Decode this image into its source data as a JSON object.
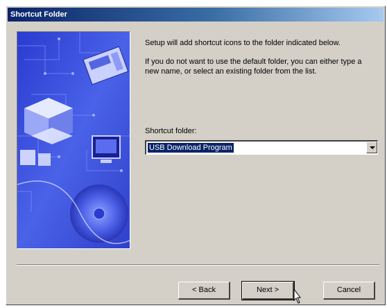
{
  "window": {
    "title": "Shortcut Folder"
  },
  "body": {
    "line1": "Setup will add shortcut icons to the folder indicated below.",
    "line2": "If you do not want to use the default folder, you can either type a new name, or select an existing folder from the list."
  },
  "folder": {
    "label": "Shortcut folder:",
    "value": "USB Download Program"
  },
  "buttons": {
    "back": "< Back",
    "next": "Next >",
    "cancel": "Cancel"
  },
  "colors": {
    "dialog_bg": "#d4d0c8",
    "selection": "#0a246a",
    "side_image_primary": "#3a4fd8"
  },
  "icons": {
    "combo_arrow": "chevron-down-icon",
    "cursor": "hand-pointer-icon"
  }
}
